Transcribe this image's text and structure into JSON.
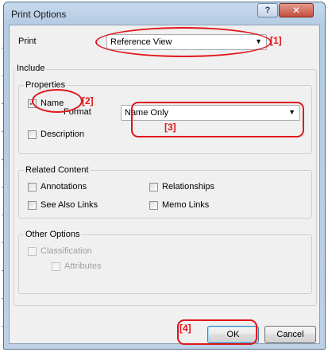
{
  "window": {
    "title": "Print Options",
    "help_glyph": "?",
    "close_glyph": "✕"
  },
  "print": {
    "label": "Print",
    "value": "Reference View"
  },
  "include": {
    "legend": "Include",
    "properties": {
      "legend": "Properties",
      "name": {
        "label": "Name",
        "checked": true,
        "check_glyph": "✓"
      },
      "format": {
        "label": "Format",
        "value": "Name Only"
      },
      "description": {
        "label": "Description",
        "checked": false
      }
    }
  },
  "related": {
    "legend": "Related Content",
    "annotations": "Annotations",
    "relationships": "Relationships",
    "see_also": "See Also Links",
    "memo_links": "Memo Links"
  },
  "other": {
    "legend": "Other Options",
    "classification": "Classification",
    "attributes": "Attributes"
  },
  "buttons": {
    "ok": "OK",
    "cancel": "Cancel"
  },
  "annotations": {
    "a1": "[1]",
    "a2": "[2]",
    "a3": "[3]",
    "a4": "[4]",
    "color": "#e0151b"
  }
}
